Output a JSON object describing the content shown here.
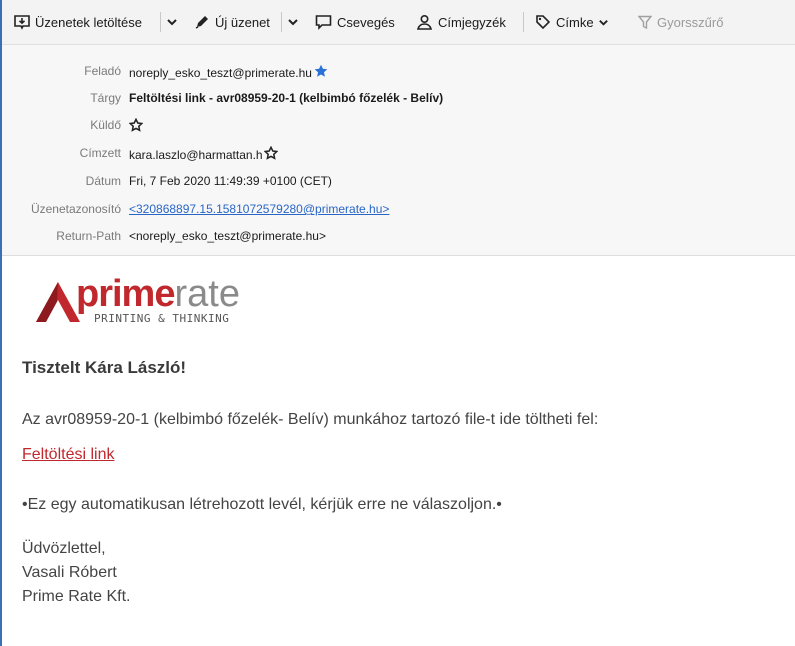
{
  "toolbar": {
    "get_messages": "Üzenetek letöltése",
    "new_message": "Új üzenet",
    "chat": "Csevegés",
    "address_book": "Címjegyzék",
    "tag": "Címke",
    "quick_filter": "Gyorsszűrő"
  },
  "header": {
    "from_label": "Feladó",
    "from_value": "noreply_esko_teszt@primerate.hu",
    "subject_label": "Tárgy",
    "subject_value": "Feltöltési link - avr08959-20-1 (kelbimbó főzelék - Belív)",
    "sender_label": "Küldő",
    "to_label": "Címzett",
    "to_value": "kara.laszlo@harmattan.h",
    "date_label": "Dátum",
    "date_value": "Fri, 7 Feb 2020 11:49:39 +0100 (CET)",
    "msgid_label": "Üzenetazonosító",
    "msgid_value": "<320868897.15.1581072579280@primerate.hu>",
    "return_label": "Return-Path",
    "return_value": "<noreply_esko_teszt@primerate.hu>"
  },
  "logo": {
    "word_bold": "prime",
    "word_light": "rate",
    "tagline": "PRINTING & THINKING"
  },
  "body": {
    "greeting": "Tisztelt Kára László!",
    "line1": "Az avr08959-20-1 (kelbimbó főzelék- Belív) munkához tartozó file-t ide töltheti fel:",
    "link": "Feltöltési link",
    "notice": "•Ez egy automatikusan létrehozott levél, kérjük erre ne válaszoljon.•",
    "closing": "Üdvözlettel,",
    "name": "Vasali Róbert",
    "company": "Prime Rate Kft."
  },
  "colors": {
    "accent": "#3b6fb6",
    "link": "#2a66c5",
    "brand_red": "#c0282d"
  }
}
